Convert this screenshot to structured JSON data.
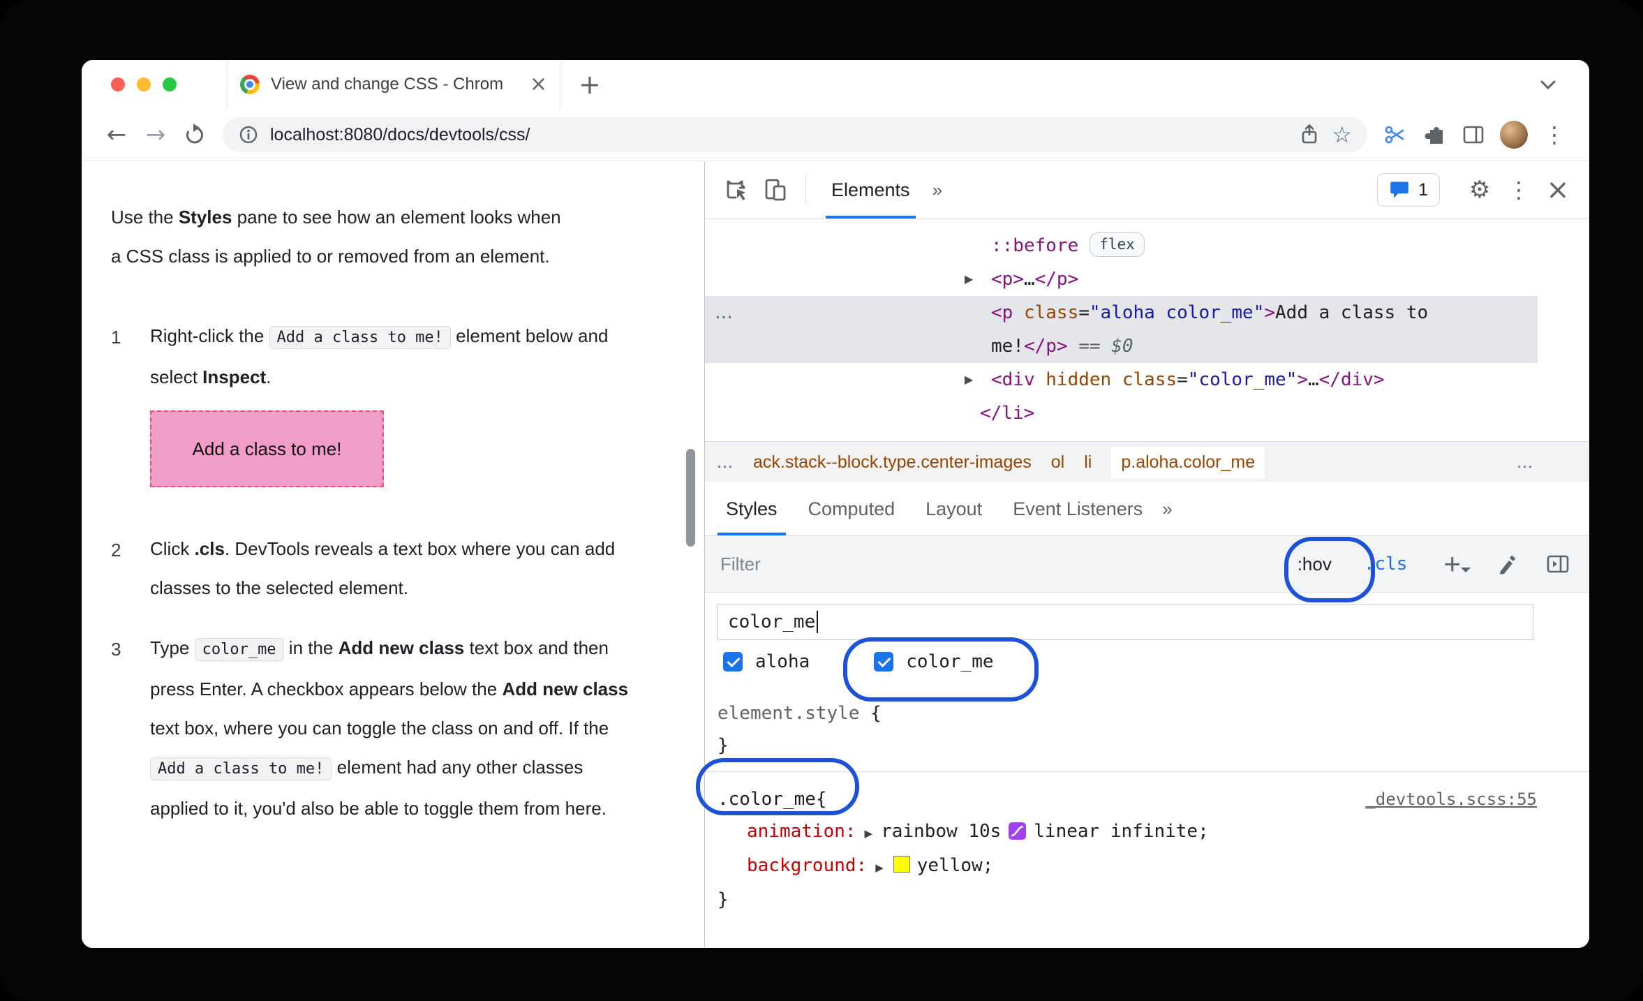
{
  "colors": {
    "accent_blue": "#1a73e8",
    "annotation_blue": "#1c51d8",
    "selection_gray": "#e4e6ea",
    "pink_box_bg": "#f29cc8",
    "pink_box_border": "#e8467c",
    "tag_purple": "#881280",
    "attr_orange": "#994500",
    "value_blue": "#1a1aa6",
    "property_red": "#c80000",
    "bezier_purple": "#a142f4",
    "swatch_yellow": "#ffff00"
  },
  "browser": {
    "tab_title": "View and change CSS - Chrom",
    "close_glyph": "×",
    "new_tab_glyph": "+",
    "url": "localhost:8080/docs/devtools/css/",
    "menu_glyph": "⋮",
    "star_glyph": "☆",
    "gear_glyph": "⚙"
  },
  "doc": {
    "intro": {
      "t1": "Use the ",
      "b1": "Styles",
      "t2": " pane to see how an element looks when a CSS class is applied to or removed from an element."
    },
    "steps": [
      {
        "num": "1",
        "t1": "Right-click the ",
        "code1": "Add a class to me!",
        "t2": " element below and select ",
        "b1": "Inspect",
        "t3": "."
      },
      {
        "num": "2",
        "t1": "Click ",
        "b1": ".cls",
        "t2": ". DevTools reveals a text box where you can add classes to the selected element."
      },
      {
        "num": "3",
        "t1": "Type ",
        "code1": "color_me",
        "t2": " in the ",
        "b1": "Add new class",
        "t3": " text box and then press Enter. A checkbox appears below the ",
        "b2": "Add new class",
        "t4": " text box, where you can toggle the class on and off. If the ",
        "code2": "Add a class to me!",
        "t5": " element had any other classes applied to it, you'd also be able to toggle them from here."
      }
    ],
    "demo_box_label": "Add a class to me!"
  },
  "devtools": {
    "toolbar": {
      "elements_tab": "Elements",
      "more": "»",
      "issues_count": "1",
      "close_glyph": "×",
      "menu_glyph": "⋮",
      "gear_glyph": "⚙"
    },
    "dom": {
      "gutter_more": "…",
      "before": {
        "pseudo": "::before",
        "badge": "flex"
      },
      "p_collapsed": {
        "arrow": "▶",
        "open": "<p>",
        "ellipsis": "…",
        "close": "</p>"
      },
      "selected": {
        "t_open": "<p",
        "attr": "class",
        "eq": "=",
        "val": "\"aloha color_me\"",
        "gt": ">",
        "text1": "Add a class to",
        "text2": "me!",
        "t_close": "</p>",
        "equals": "==",
        "dollar": "$0"
      },
      "div_row": {
        "arrow": "▶",
        "t_open": "<div",
        "attr1": "hidden",
        "attr2": "class",
        "eq": "=",
        "val": "\"color_me\"",
        "gt": ">",
        "ellipsis": "…",
        "t_close": "</div>"
      },
      "li_close": "</li>"
    },
    "crumbs": {
      "lead": "…",
      "c1": "ack.stack--block.type.center-images",
      "c2": "ol",
      "c3": "li",
      "c4": "p.aloha.color_me",
      "trail": "…"
    },
    "tabs": {
      "t1": "Styles",
      "t2": "Computed",
      "t3": "Layout",
      "t4": "Event Listeners",
      "more": "»"
    },
    "filter": {
      "placeholder": "Filter",
      "hov": ":hov",
      "cls": ".cls",
      "plus": "+"
    },
    "class_editor": {
      "input_value": "color_me",
      "cb1": "aloha",
      "cb2": "color_me"
    },
    "styles": {
      "element_style": {
        "selector": "element.style",
        "open": " {",
        "close": "}"
      },
      "rule": {
        "selector": ".color_me",
        "open": " {",
        "source": "_devtools.scss:55",
        "p1_name": "animation:",
        "p1_v1": "rainbow 10s",
        "p1_v2": "linear infinite;",
        "p2_name": "background:",
        "p2_v": "yellow;",
        "close": "}"
      }
    }
  }
}
